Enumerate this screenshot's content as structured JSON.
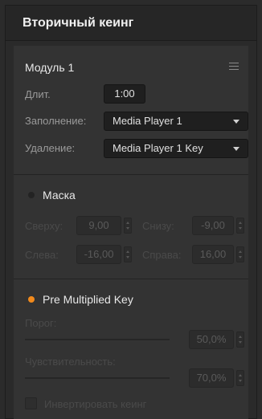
{
  "header": {
    "title": "Вторичный кеинг"
  },
  "module": {
    "title": "Модуль 1",
    "duration_label": "Длит.",
    "duration_value": "1:00",
    "fill_label": "Заполнение:",
    "fill_value": "Media Player 1",
    "key_label": "Удаление:",
    "key_value": "Media Player 1 Key"
  },
  "mask": {
    "title": "Маска",
    "enabled": false,
    "top_label": "Сверху:",
    "top_value": "9,00",
    "bottom_label": "Снизу:",
    "bottom_value": "-9,00",
    "left_label": "Слева:",
    "left_value": "-16,00",
    "right_label": "Справа:",
    "right_value": "16,00"
  },
  "premultiplied": {
    "title": "Pre Multiplied Key",
    "enabled": true,
    "clip_label": "Порог:",
    "clip_value": "50,0%",
    "gain_label": "Чувствительность:",
    "gain_value": "70,0%",
    "invert_label": "Инвертировать кеинг"
  },
  "colors": {
    "accent": "#f28a1c",
    "panel": "#333333",
    "background": "#2a2a2a"
  }
}
